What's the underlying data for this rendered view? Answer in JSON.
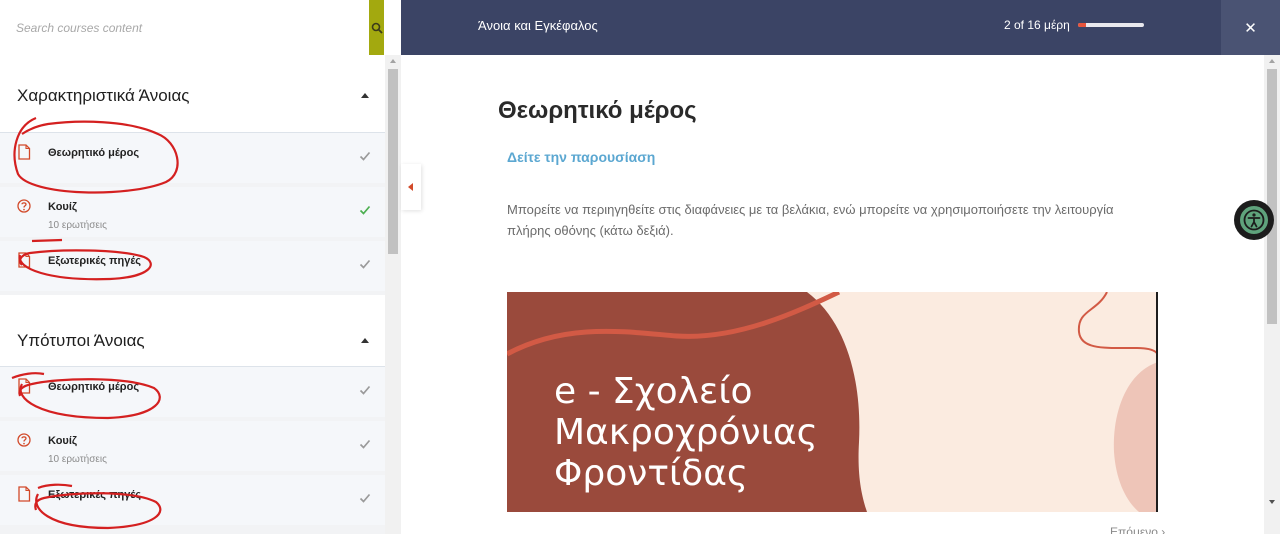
{
  "search": {
    "placeholder": "Search courses content"
  },
  "header": {
    "course_title": "Άνοια και Εγκέφαλος",
    "progress_text": "2 of 16 μέρη",
    "progress_fraction": 0.125,
    "close_label": "✕"
  },
  "sidebar": {
    "sections": [
      {
        "title": "Χαρακτηριστικά Άνοιας",
        "items": [
          {
            "label": "Θεωρητικό μέρος",
            "sub": "",
            "icon": "document-icon",
            "status": "complete"
          },
          {
            "label": "Κουίζ",
            "sub": "10 ερωτήσεις",
            "icon": "quiz-question-icon",
            "status": "complete-active"
          },
          {
            "label": "Εξωτερικές πηγές",
            "sub": "",
            "icon": "document-icon",
            "status": "complete"
          }
        ]
      },
      {
        "title": "Υπότυποι Άνοιας",
        "items": [
          {
            "label": "Θεωρητικό μέρος",
            "sub": "",
            "icon": "document-icon",
            "status": "complete"
          },
          {
            "label": "Κουίζ",
            "sub": "10 ερωτήσεις",
            "icon": "quiz-question-icon",
            "status": "complete"
          },
          {
            "label": "Εξωτερικές πηγές",
            "sub": "",
            "icon": "document-icon",
            "status": "complete"
          }
        ]
      }
    ]
  },
  "main": {
    "title": "Θεωρητικό μέρος",
    "link": "Δείτε την παρουσίαση",
    "description": "Μπορείτε να περιηγηθείτε στις διαφάνειες με τα βελάκια, ενώ μπορείτε να χρησιμοποιήσετε την λειτουργία πλήρης οθόνης (κάτω δεξιά).",
    "slide": {
      "line1": "e - Σχολείο",
      "line2": "Μακροχρόνιας",
      "line3": "Φροντίδας"
    },
    "next_label": "Επόμενο ›"
  },
  "colors": {
    "header_bg": "#3b4465",
    "accent_green": "#a3a90f",
    "link_blue": "#5ba7d1",
    "icon_red": "#d24a2a",
    "slide_brown": "#9a4a3c",
    "slide_cream": "#fbebe0",
    "check_green": "#4caf50",
    "check_gray": "#9a9a9a",
    "annotation_red": "#d42020"
  }
}
